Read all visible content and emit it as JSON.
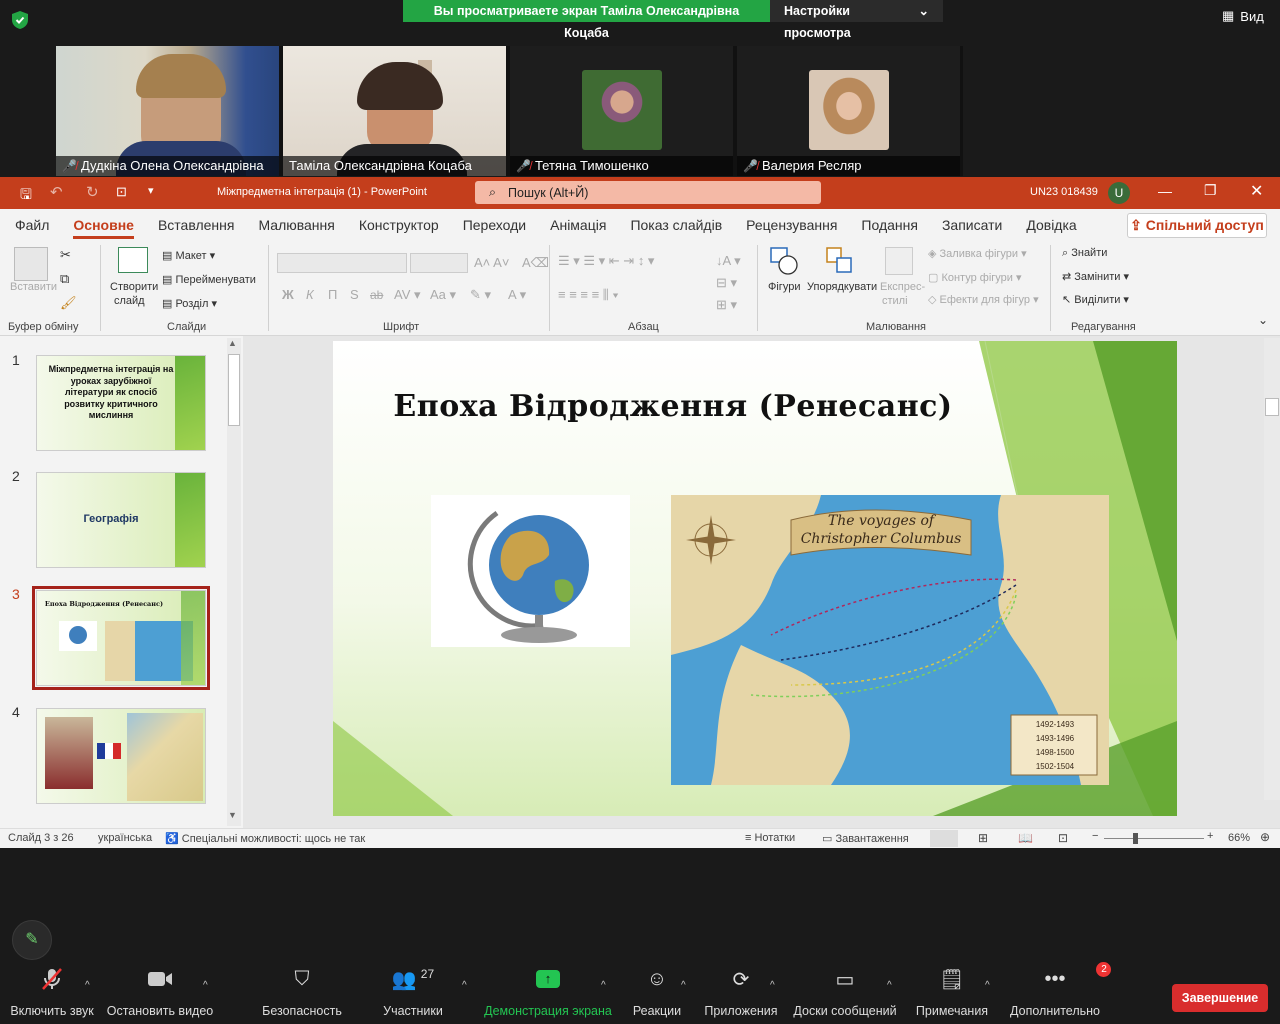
{
  "zoom": {
    "share_banner": "Вы просматриваете экран Таміла Олександрівна Коцаба",
    "view_settings": "Настройки просмотра",
    "view_button": "Вид",
    "participants": [
      {
        "name": "Дудкіна Олена Олександрівна",
        "muted": true
      },
      {
        "name": "Таміла Олександрівна Коцаба",
        "muted": false
      },
      {
        "name": "Тетяна Тимошенко",
        "muted": true
      },
      {
        "name": "Валерия Ресляр",
        "muted": true
      }
    ],
    "toolbar": {
      "unmute": "Включить звук",
      "stop_video": "Остановить видео",
      "security": "Безопасность",
      "participants": "Участники",
      "participants_count": "27",
      "share_screen": "Демонстрация экрана",
      "reactions": "Реакции",
      "apps": "Приложения",
      "whiteboards": "Доски сообщений",
      "notes": "Примечания",
      "more": "Дополнительно",
      "more_badge": "2",
      "end": "Завершение"
    }
  },
  "ppt": {
    "doc_title": "Міжпредметна інтеграція (1)  -  PowerPoint",
    "search_placeholder": "Пошук (Alt+Й)",
    "user_code": "UN23 018439",
    "user_initial": "U",
    "tabs": [
      "Файл",
      "Основне",
      "Вставлення",
      "Малювання",
      "Конструктор",
      "Переходи",
      "Анімація",
      "Показ слайдів",
      "Рецензування",
      "Подання",
      "Записати",
      "Довідка"
    ],
    "share_button": "Спільний доступ",
    "ribbon": {
      "paste": "Вставити",
      "clipboard": "Буфер обміну",
      "new_slide_1": "Створити",
      "new_slide_2": "слайд",
      "layout": "Макет",
      "rename": "Перейменувати",
      "section": "Розділ",
      "slides": "Слайди",
      "bold": "Ж",
      "italic": "К",
      "underline": "П",
      "strike": "S",
      "strike2": "ab",
      "font": "Шрифт",
      "paragraph": "Абзац",
      "shapes": "Фігури",
      "arrange": "Упорядкувати",
      "quick_styles_1": "Експрес-",
      "quick_styles_2": "стилі",
      "shape_fill": "Заливка фігури",
      "shape_outline": "Контур фігури",
      "shape_effects": "Ефекти для фігур",
      "drawing": "Малювання",
      "find": "Знайти",
      "replace": "Замінити",
      "select": "Виділити",
      "editing": "Редагування"
    },
    "thumbnails": [
      {
        "num": "1",
        "text": "Міжпредметна інтеграція на уроках зарубіжної літератури як спосіб розвитку критичного мислиння"
      },
      {
        "num": "2",
        "text": "Географія"
      },
      {
        "num": "3",
        "text": "Епоха Відродження (Ренесанс)"
      },
      {
        "num": "4",
        "text": ""
      }
    ],
    "slide": {
      "title": "Епоха Відродження (Ренесанс)",
      "map_title_1": "The voyages of",
      "map_title_2": "Christopher Columbus",
      "legend": [
        "1492-1493",
        "1493-1496",
        "1498-1500",
        "1502-1504"
      ]
    },
    "status": {
      "slide_of": "Слайд 3 з 26",
      "language": "українська",
      "accessibility": "Спеціальні можливості: щось не так",
      "notes": "Нотатки",
      "uploading": "Завантаження",
      "zoom": "66%"
    }
  }
}
